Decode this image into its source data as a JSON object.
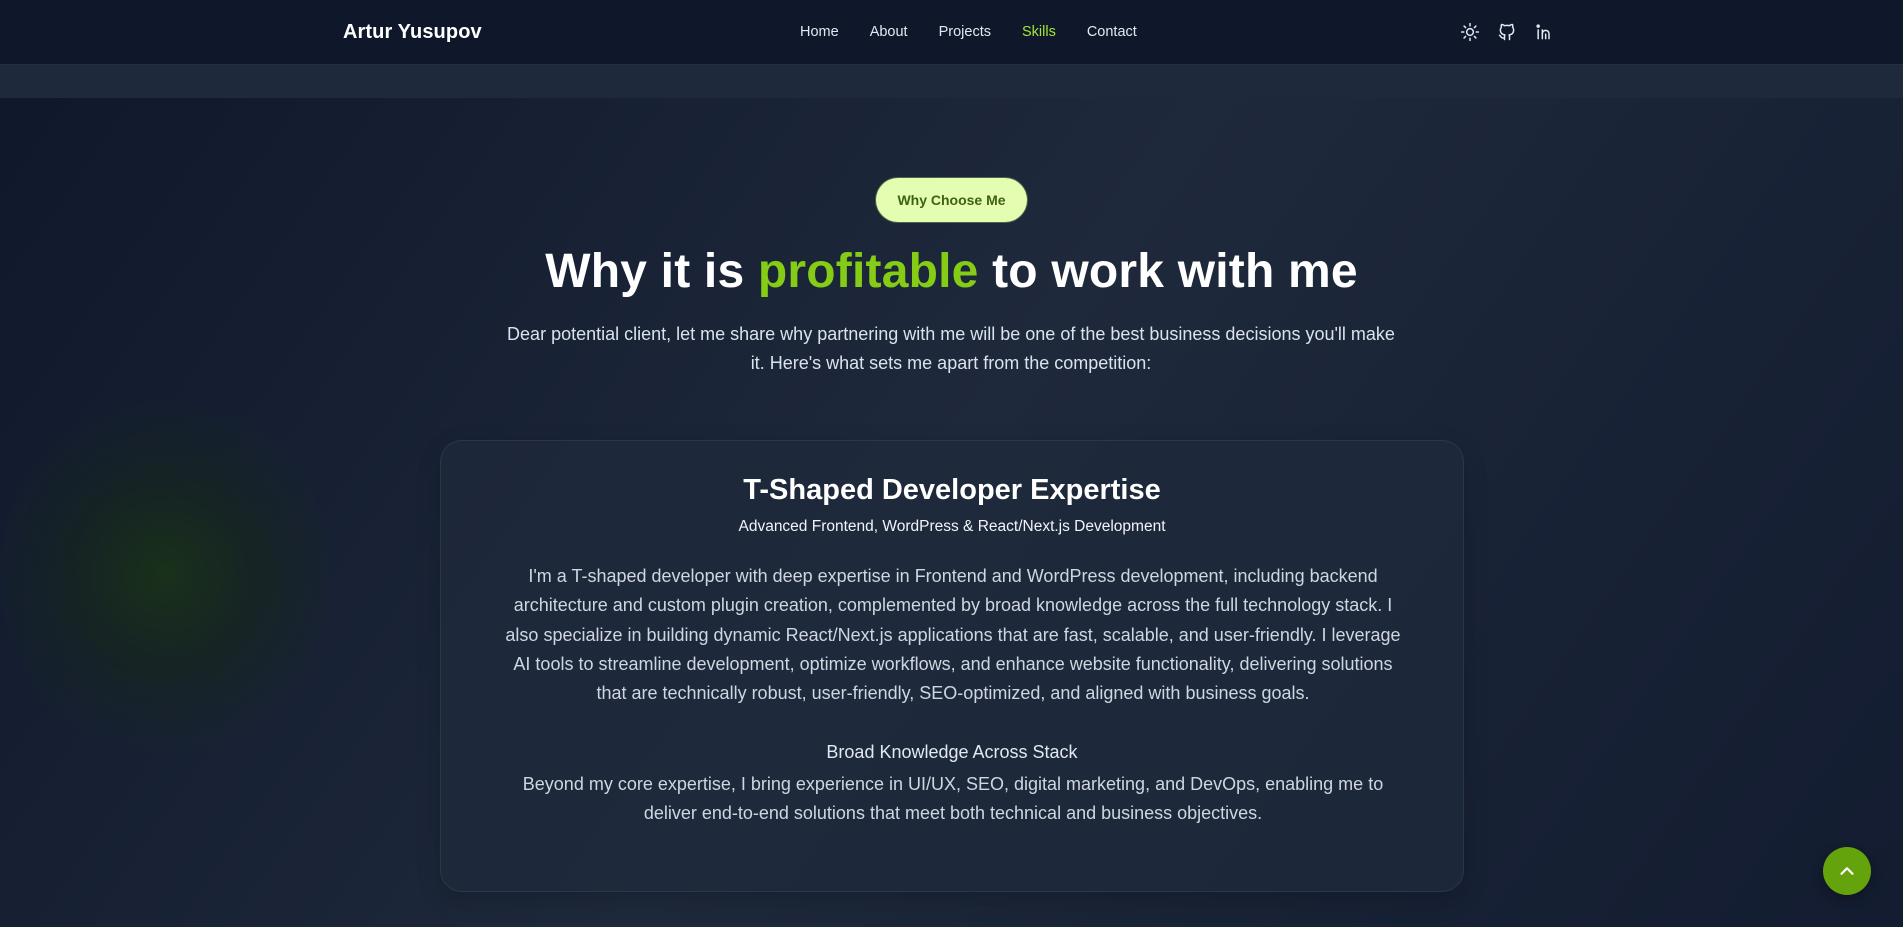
{
  "brand": "Artur Yusupov",
  "nav": {
    "items": [
      {
        "label": "Home"
      },
      {
        "label": "About"
      },
      {
        "label": "Projects"
      },
      {
        "label": "Skills"
      },
      {
        "label": "Contact"
      }
    ],
    "active": "Skills"
  },
  "icons": {
    "theme": "sun-icon",
    "github": "github-icon",
    "linkedin": "linkedin-icon",
    "scroll_top": "chevron-up-icon"
  },
  "hero": {
    "badge": "Why Choose Me",
    "headline_before": "Why it is ",
    "headline_accent": "profitable",
    "headline_after": " to work with me",
    "intro": "Dear potential client, let me share why partnering with me will be one of the best business decisions you'll make it. Here's what sets me apart from the competition:"
  },
  "card": {
    "title": "T-Shaped Developer Expertise",
    "subtitle": "Advanced Frontend, WordPress & React/Next.js Development",
    "body": "I'm a T-shaped developer with deep expertise in Frontend and WordPress development, including backend architecture and custom plugin creation, complemented by broad knowledge across the full technology stack. I also specialize in building dynamic React/Next.js applications that are fast, scalable, and user-friendly. I leverage AI tools to streamline development, optimize workflows, and enhance website functionality, delivering solutions that are technically robust, user-friendly, SEO-optimized, and aligned with business goals.",
    "section_title": "Broad Knowledge Across Stack",
    "section_body": "Beyond my core expertise, I bring experience in UI/UX, SEO, digital marketing, and DevOps, enabling me to deliver end-to-end solutions that meet both technical and business objectives."
  },
  "colors": {
    "accent": "#84cc16",
    "active_nav": "#a3e635",
    "badge_bg": "#e4fdb0",
    "badge_text": "#3f6212",
    "background": "#0f172a",
    "card_bg": "#1e293b",
    "scroll_button": "#65a30d"
  }
}
